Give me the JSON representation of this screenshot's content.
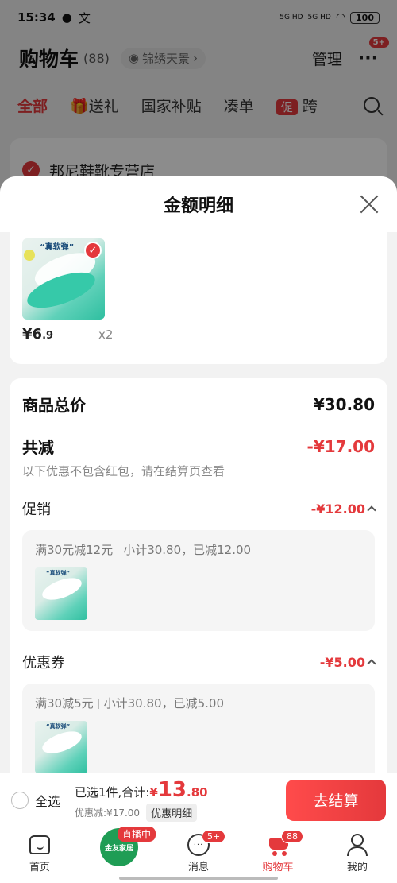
{
  "status_bar": {
    "time": "15:34",
    "signal1": "5G HD",
    "signal2": "5G HD",
    "battery": "100"
  },
  "cart_header": {
    "title": "购物车",
    "count": "(88)",
    "location": "锦绣天景",
    "manage": "管理",
    "more_badge": "5+"
  },
  "filter_tabs": [
    "全部",
    "送礼",
    "国家补贴",
    "凑单",
    "跨"
  ],
  "promo_chip": "促",
  "store": {
    "name": "邦尼鞋靴专营店"
  },
  "sheet": {
    "title": "金额明细",
    "goods": {
      "thumb_text": "“真软弹”",
      "price_yen": "¥6",
      "price_dec": ".9",
      "qty": "x2"
    },
    "total": {
      "label": "商品总价",
      "value": "¥30.80"
    },
    "discount": {
      "label": "共减",
      "value": "-¥17.00",
      "note": "以下优惠不包含红包，请在结算页查看"
    },
    "promotion": {
      "label": "促销",
      "value": "-¥12.00",
      "rule": "满30元减12元",
      "subtotal": "小计30.80，已减12.00",
      "thumb_text": "“真软弹”"
    },
    "coupon": {
      "label": "优惠券",
      "value": "-¥5.00",
      "rule": "满30减5元",
      "subtotal": "小计30.80，已减5.00",
      "thumb_text": "“真软弹”"
    }
  },
  "checkout": {
    "select_all": "全选",
    "selected": "已选1件,合计:",
    "total_yen": "¥",
    "total_int": "13",
    "total_dec": ".80",
    "discount_text": "优惠减:¥17.00",
    "detail_chip": "优惠明细",
    "pay_button": "去结算"
  },
  "tab_bar": {
    "home": "首页",
    "live_badge": "直播中",
    "live_logo": "金友家居",
    "messages": "消息",
    "messages_badge": "5+",
    "cart": "购物车",
    "cart_badge": "88",
    "me": "我的"
  },
  "colors": {
    "accent": "#e4393c"
  }
}
